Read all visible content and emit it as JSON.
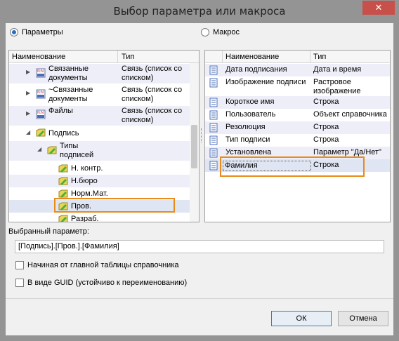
{
  "window": {
    "title": "Выбор параметра или макроса",
    "close_glyph": "✕"
  },
  "mode": {
    "params_label": "Параметры",
    "macro_label": "Макрос",
    "selected": "params"
  },
  "left_table": {
    "columns": [
      "Наименование",
      "Тип"
    ],
    "rows": [
      {
        "name": "Связанные документы",
        "type": "Связь (список со списком)",
        "icon": "link-icon",
        "expanded": false
      },
      {
        "name": "~Связанные документы",
        "type": "Связь (список со списком)",
        "icon": "link-icon",
        "expanded": false
      },
      {
        "name": "Файлы",
        "type": "Связь (список со списком)",
        "icon": "link-icon",
        "expanded": false
      },
      {
        "name": "Подпись",
        "type": "",
        "icon": "folder-icon",
        "expanded": true
      },
      {
        "name": "Типы подписей",
        "type": "",
        "icon": "folder-icon",
        "expanded": true
      },
      {
        "name": "Н. контр.",
        "type": "",
        "icon": "folder-icon"
      },
      {
        "name": "Н.бюро",
        "type": "",
        "icon": "folder-icon"
      },
      {
        "name": "Норм.Мат.",
        "type": "",
        "icon": "folder-icon"
      },
      {
        "name": "Пров.",
        "type": "",
        "icon": "folder-icon",
        "selected": true
      },
      {
        "name": "Разраб.",
        "type": "",
        "icon": "folder-icon"
      }
    ]
  },
  "right_table": {
    "columns": [
      "Наименование",
      "Тип"
    ],
    "rows": [
      {
        "name": "Дата подписания",
        "type": "Дата и время"
      },
      {
        "name": "Изображение подписи",
        "type": "Растровое изображение"
      },
      {
        "name": "Короткое имя",
        "type": "Строка"
      },
      {
        "name": "Пользователь",
        "type": "Объект справочника"
      },
      {
        "name": "Резолюция",
        "type": "Строка"
      },
      {
        "name": "Тип подписи",
        "type": "Строка"
      },
      {
        "name": "Установлена",
        "type": "Параметр \"Да/Нет\""
      },
      {
        "name": "Фамилия",
        "type": "Строка",
        "selected": true
      }
    ]
  },
  "selected_param": {
    "label": "Выбранный параметр:",
    "value": "[Подпись].[Пров.].[Фамилия]"
  },
  "options": {
    "from_main_table": "Начиная от главной таблицы справочника",
    "as_guid": "В виде GUID (устойчиво  к переименованию)"
  },
  "buttons": {
    "ok": "ОК",
    "cancel": "Отмена"
  },
  "colors": {
    "highlight": "#e88b1a",
    "accent": "#2a6cc4",
    "close": "#c7504a"
  }
}
